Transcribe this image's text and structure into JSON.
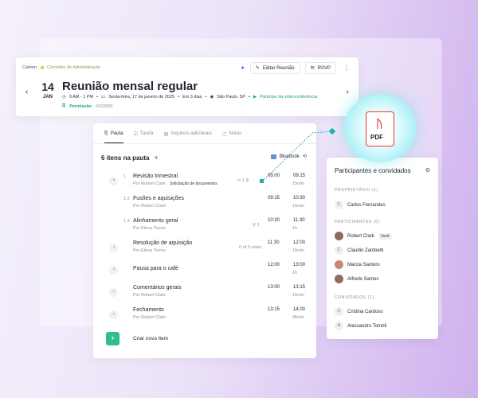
{
  "header": {
    "org": "Carbon",
    "crumb": "Conselho de Administração",
    "actions": {
      "edit": "Editar Reunião",
      "rsvp": "RSVP"
    },
    "date": {
      "day": "14",
      "month": "JAN"
    },
    "title": "Reunião mensal regular",
    "meta": {
      "time": "9 AM - 1 PM",
      "date": "Sexta-feira, 17 de janeiro de 2025",
      "countdown": "Em 3 dias",
      "location": "São Paulo, SP",
      "video": "Participe da videoconferência"
    },
    "permission": "Permissão",
    "code": "#202500"
  },
  "tabs": [
    "Pauta",
    "Tarefa",
    "Arquivos adicionais",
    "Notas"
  ],
  "agenda": {
    "count_label": "6 itens na pauta",
    "bluebook": "Bluebook",
    "items": [
      {
        "idx": "1",
        "title": "Revisão trimestral",
        "presenter": "Por Robert Clark",
        "badge": "Solicitação de documentos",
        "extra": "1",
        "start": "09:00",
        "end": "09:15",
        "duration": "15min"
      },
      {
        "idx": "1.2",
        "title": "Fusões e aquisições",
        "presenter": "Por Robert Clark",
        "badge": "",
        "extra": "",
        "start": "09:15",
        "end": "10:30",
        "duration": "15min"
      },
      {
        "idx": "1.3",
        "title": "Alinhamento geral",
        "presenter": "Por Elena Torres",
        "badge": "",
        "extra": "1",
        "start": "10:30",
        "end": "11:30",
        "duration": "1h"
      },
      {
        "idx": "",
        "title": "Resolução de aquisição",
        "presenter": "Por Elena Torres",
        "badge": "",
        "extra": "0 of 3 votes",
        "start": "11:30",
        "end": "12:00",
        "duration": "15min"
      },
      {
        "idx": "",
        "title": "Pausa para o café",
        "presenter": "",
        "badge": "",
        "extra": "",
        "start": "12:00",
        "end": "13:00",
        "duration": "1h"
      },
      {
        "idx": "",
        "title": "Comentários gerais",
        "presenter": "Por Robert Clark",
        "badge": "",
        "extra": "",
        "start": "13:00",
        "end": "13:15",
        "duration": "15min"
      },
      {
        "idx": "",
        "title": "Fechamento",
        "presenter": "Por Robert Clark",
        "badge": "",
        "extra": "",
        "start": "13:15",
        "end": "14:00",
        "duration": "45min"
      }
    ],
    "add_label": "Criar  novo item"
  },
  "participants": {
    "title": "Participantes e convidados",
    "sections": {
      "owner": "PROPRIETÁRIO (1)",
      "participants": "PARTICIPANTES (5)",
      "guests": "CONVIDADOS (2)"
    },
    "owner": [
      {
        "initial": "C",
        "name": "Carlos Fernandes"
      }
    ],
    "members": [
      {
        "initial": "",
        "name": "Robert Clark",
        "tag": "Você"
      },
      {
        "initial": "C",
        "name": "Cláudio Zambetti",
        "tag": ""
      },
      {
        "initial": "",
        "name": "Marcia Santoro",
        "tag": ""
      },
      {
        "initial": "",
        "name": "Alfredo Santos",
        "tag": ""
      }
    ],
    "guests": [
      {
        "initial": "C",
        "name": "Cristina Cardoso"
      },
      {
        "initial": "A",
        "name": "Alessandro Torrelli"
      }
    ]
  },
  "pdf": {
    "label": "PDF"
  },
  "colors": {
    "accent": "#2fbf8f",
    "pdf": "#e53935",
    "connector": "#19b3a8"
  }
}
